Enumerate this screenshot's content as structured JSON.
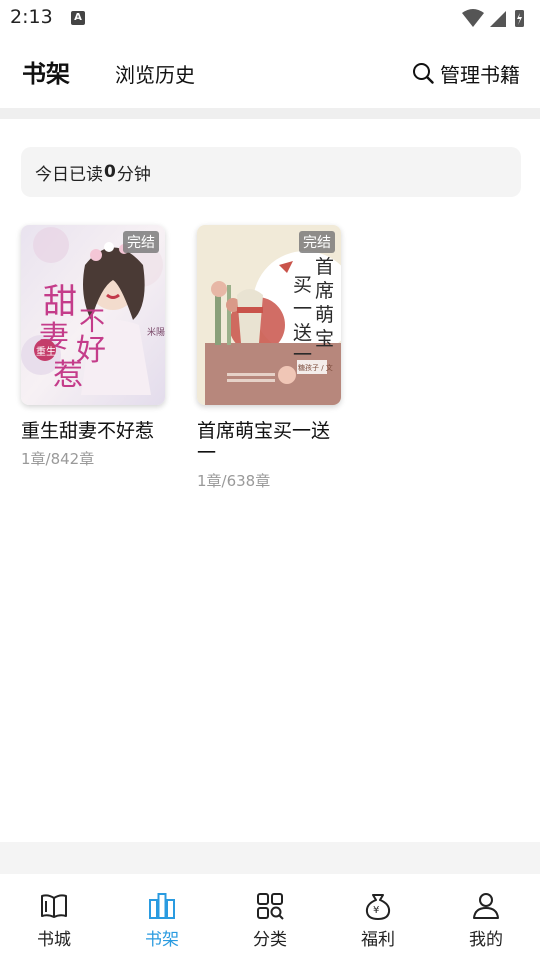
{
  "status_bar": {
    "time": "2:13",
    "notification_letter": "A"
  },
  "header": {
    "tabs": [
      {
        "label": "书架",
        "active": true
      },
      {
        "label": "浏览历史",
        "active": false
      }
    ],
    "manage_label": "管理书籍"
  },
  "reading_today": {
    "prefix": "今日已读",
    "minutes": "0",
    "suffix": "分钟"
  },
  "books": [
    {
      "title": "重生甜妻不好惹",
      "progress": "1章/842章",
      "status_badge": "完结",
      "cover_text": [
        "甜",
        "妻",
        "不",
        "好",
        "惹"
      ],
      "cover_subtext": "重生",
      "cover_author": "米陽"
    },
    {
      "title": "首席萌宝买一送一",
      "progress": "1章/638章",
      "status_badge": "完结",
      "cover_text": [
        "首",
        "席",
        "萌",
        "宝",
        "买",
        "一",
        "送",
        "一"
      ],
      "cover_author": "糖孩子 / 文"
    }
  ],
  "tabbar": [
    {
      "label": "书城",
      "icon": "book-open-icon",
      "active": false
    },
    {
      "label": "书架",
      "icon": "bookshelf-icon",
      "active": true
    },
    {
      "label": "分类",
      "icon": "category-grid-icon",
      "active": false
    },
    {
      "label": "福利",
      "icon": "money-bag-icon",
      "active": false
    },
    {
      "label": "我的",
      "icon": "user-icon",
      "active": false
    }
  ],
  "colors": {
    "accent": "#2a9be0",
    "badge_bg": "#787878",
    "separator": "#efefef"
  }
}
